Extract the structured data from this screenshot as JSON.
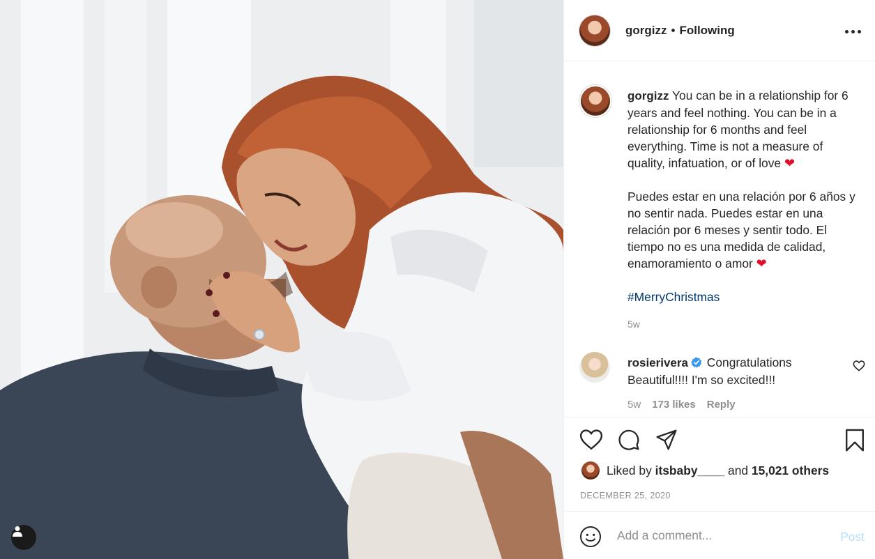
{
  "post": {
    "username": "gorgizz",
    "separator": "•",
    "follow_status": "Following",
    "caption_username": "gorgizz",
    "caption_p1": "You can be in a relationship for 6 years and feel nothing. You can be in a relationship for 6 months and feel everything. Time is not a measure of quality, infatuation, or of love",
    "caption_p2": "Puedes estar en una relación por 6 años y no sentir nada. Puedes estar en una relación por 6 meses y sentir todo. El tiempo no es una medida de calidad, enamoramiento o amor",
    "heart_emoji": "❤",
    "hashtag": "#MerryChristmas",
    "caption_time": "5w"
  },
  "comment": {
    "username": "rosierivera",
    "text": "Congratulations Beautiful!!!! I'm so excited!!!",
    "time": "5w",
    "likes": "173 likes",
    "reply_label": "Reply"
  },
  "likes": {
    "prefix": "Liked by",
    "liker": "itsbaby____",
    "and": "and",
    "others": "15,021 others"
  },
  "date": "DECEMBER 25, 2020",
  "add_comment": {
    "placeholder": "Add a comment...",
    "post_label": "Post"
  },
  "icons": {
    "more": "more-options-icon",
    "like": "heart-icon",
    "comment": "comment-icon",
    "share": "share-icon",
    "save": "bookmark-icon",
    "emoji": "smiley-icon",
    "verified": "verified-badge-icon",
    "user_tag": "user-tag-icon"
  },
  "colors": {
    "hashtag": "#00376b",
    "verified": "#3897f0",
    "post_button_disabled": "#b2dffc",
    "muted": "#8e8e8e"
  }
}
